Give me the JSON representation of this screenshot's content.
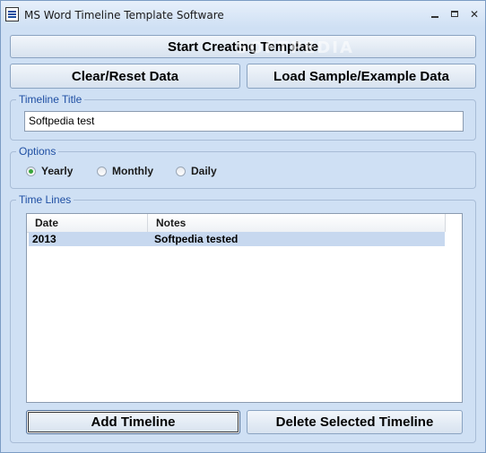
{
  "window": {
    "title": "MS Word Timeline Template Software"
  },
  "toolbar": {
    "start_label": "Start Creating Template",
    "clear_label": "Clear/Reset Data",
    "load_label": "Load Sample/Example Data"
  },
  "timeline_title": {
    "group_label": "Timeline Title",
    "value": "Softpedia test"
  },
  "options": {
    "group_label": "Options",
    "items": [
      {
        "label": "Yearly",
        "checked": true
      },
      {
        "label": "Monthly",
        "checked": false
      },
      {
        "label": "Daily",
        "checked": false
      }
    ]
  },
  "time_lines": {
    "group_label": "Time Lines",
    "columns": [
      "Date",
      "Notes"
    ],
    "rows": [
      {
        "date": "2013",
        "notes": "Softpedia tested"
      }
    ]
  },
  "bottom": {
    "add_label": "Add Timeline",
    "delete_label": "Delete Selected Timeline"
  },
  "watermark": "SOFTPEDIA",
  "colors": {
    "window_bg": "#cfe0f4",
    "group_label": "#1f4fa3",
    "selected_row": "#c7d8ef",
    "radio_checked": "#39a63a"
  }
}
